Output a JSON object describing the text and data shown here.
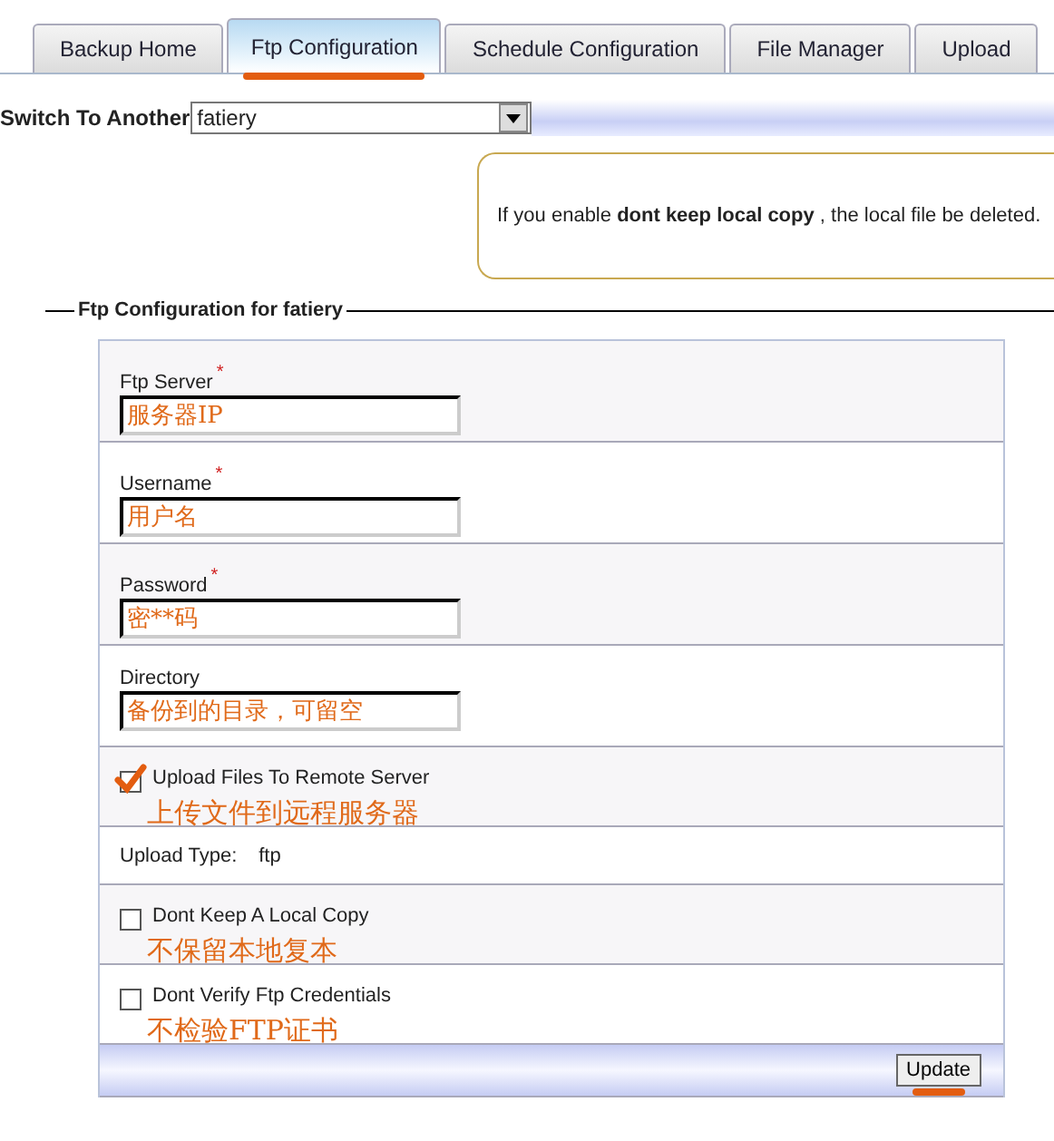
{
  "tabs": [
    {
      "label": "Backup Home",
      "selected": false
    },
    {
      "label": "Ftp Configuration",
      "selected": true
    },
    {
      "label": "Schedule Configuration",
      "selected": false
    },
    {
      "label": "File Manager",
      "selected": false
    },
    {
      "label": "Upload",
      "selected": false
    }
  ],
  "switch": {
    "label": "Switch To Another",
    "value": "fatiery"
  },
  "notice": {
    "text": "If you enable **dont keep local copy** , the local file be deleted."
  },
  "section": {
    "title": "Ftp Configuration for fatiery"
  },
  "fields": [
    {
      "label": "Ftp Server",
      "required_mark": "*",
      "value": "服务器IP"
    },
    {
      "label": "Username",
      "required_mark": "*",
      "value": "用户名"
    },
    {
      "label": "Password",
      "required_mark": "*",
      "value": "密**码"
    },
    {
      "label": "Directory",
      "value": "备份到的目录，可留空"
    }
  ],
  "options": [
    {
      "kind": "checkbox",
      "label": "Upload Files To Remote Server",
      "checked": true,
      "note": "上传文件到远程服务器"
    },
    {
      "kind": "info",
      "label": "Upload Type:",
      "value": "ftp"
    },
    {
      "kind": "checkbox",
      "label": "Dont Keep A Local Copy",
      "checked": false,
      "note": "不保留本地复本"
    },
    {
      "kind": "checkbox",
      "label": "Dont Verify Ftp Credentials",
      "checked": false,
      "note": "不检验FTP证书"
    }
  ],
  "update_button": {
    "label": "Update"
  }
}
